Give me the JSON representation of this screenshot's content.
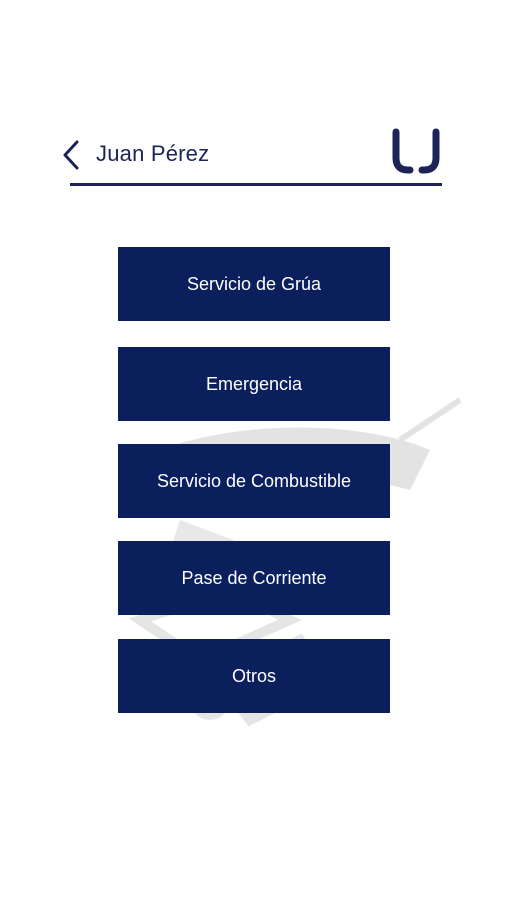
{
  "header": {
    "user_name": "Juan Pérez",
    "back_icon": "chevron-left-icon",
    "logo_icon": "brand-logo"
  },
  "menu": {
    "items": [
      {
        "label": "Servicio de Grúa"
      },
      {
        "label": "Emergencia"
      },
      {
        "label": "Servicio de Combustible"
      },
      {
        "label": "Pase de Corriente"
      },
      {
        "label": "Otros"
      }
    ]
  },
  "colors": {
    "primary": "#0a1f5c",
    "text_dark": "#1b2357",
    "background": "#ffffff"
  }
}
